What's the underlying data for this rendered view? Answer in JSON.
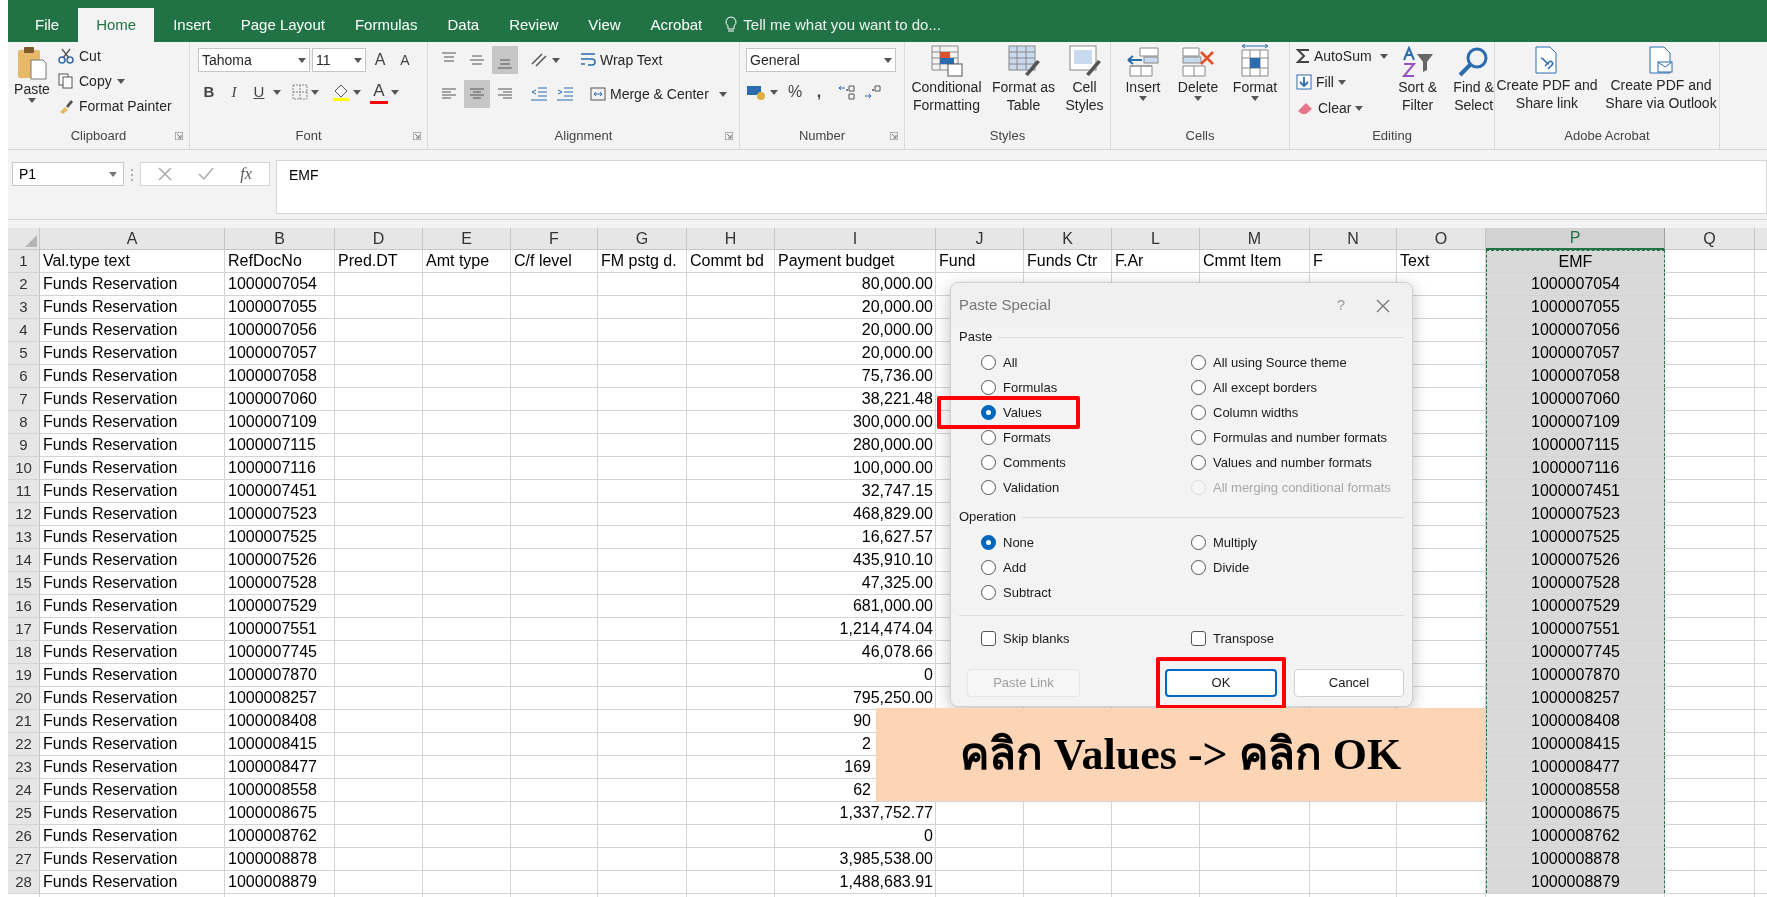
{
  "menu_tabs": [
    {
      "label": "File",
      "selected": false
    },
    {
      "label": "Home",
      "selected": true
    },
    {
      "label": "Insert",
      "selected": false
    },
    {
      "label": "Page Layout",
      "selected": false
    },
    {
      "label": "Formulas",
      "selected": false
    },
    {
      "label": "Data",
      "selected": false
    },
    {
      "label": "Review",
      "selected": false
    },
    {
      "label": "View",
      "selected": false
    },
    {
      "label": "Acrobat",
      "selected": false
    }
  ],
  "tell_me": "Tell me what you want to do...",
  "ribbon": {
    "clipboard": {
      "label": "Clipboard",
      "paste": "Paste",
      "cut": "Cut",
      "copy": "Copy",
      "format_painter": "Format Painter"
    },
    "font": {
      "label": "Font",
      "font_name": "Tahoma",
      "font_size": "11",
      "grow": "A",
      "shrink": "A",
      "bold": "B",
      "italic": "I",
      "underline": "U",
      "font_color": "A"
    },
    "alignment": {
      "label": "Alignment",
      "wrap_text": "Wrap Text",
      "merge_center": "Merge & Center",
      "vertical_buttons": [
        {
          "selected": false
        },
        {
          "selected": false
        },
        {
          "selected": true
        }
      ],
      "horizontal_buttons": [
        {
          "selected": false
        },
        {
          "selected": true
        },
        {
          "selected": false
        }
      ]
    },
    "number": {
      "label": "Number",
      "format": "General",
      "percent": "%",
      "comma": ","
    },
    "styles": {
      "label": "Styles",
      "conditional": "Conditional Formatting",
      "format_table": "Format as Table",
      "cell_styles": "Cell Styles"
    },
    "cells": {
      "label": "Cells",
      "insert": "Insert",
      "delete": "Delete",
      "format": "Format"
    },
    "editing": {
      "label": "Editing",
      "autosum": "AutoSum",
      "fill": "Fill",
      "clear": "Clear",
      "sort_filter": "Sort & Filter",
      "find_select": "Find & Select"
    },
    "acrobat": {
      "label": "Adobe Acrobat",
      "create_share": "Create PDF and Share link",
      "create_outlook": "Create PDF and Share via Outlook"
    }
  },
  "formula_bar": {
    "name_box": "P1",
    "fx": "fx",
    "formula": "EMF"
  },
  "sheet": {
    "columns": [
      {
        "letter": "A",
        "selected": false
      },
      {
        "letter": "B",
        "selected": false
      },
      {
        "letter": "D",
        "selected": false
      },
      {
        "letter": "E",
        "selected": false
      },
      {
        "letter": "F",
        "selected": false
      },
      {
        "letter": "G",
        "selected": false
      },
      {
        "letter": "H",
        "selected": false
      },
      {
        "letter": "I",
        "selected": false
      },
      {
        "letter": "J",
        "selected": false
      },
      {
        "letter": "K",
        "selected": false
      },
      {
        "letter": "L",
        "selected": false
      },
      {
        "letter": "M",
        "selected": false
      },
      {
        "letter": "N",
        "selected": false
      },
      {
        "letter": "O",
        "selected": false
      },
      {
        "letter": "P",
        "selected": true
      },
      {
        "letter": "Q",
        "selected": false
      }
    ],
    "rows": [
      {
        "row": "1",
        "kind": "labels",
        "cells": {
          "A": "Val.type text",
          "B": "RefDocNo",
          "D": "Pred.DT",
          "E": "Amt type",
          "F": "C/f level",
          "G": "FM pstg d.",
          "H": "Commt bd",
          "I": "Payment budget",
          "J": "Fund",
          "K": "Funds Ctr",
          "L": "F.Ar",
          "M": "Cmmt Item",
          "N": "F",
          "O": "Text",
          "P": "EMF"
        }
      },
      {
        "row": "2",
        "kind": "data",
        "cells": {
          "A": "Funds Reservation",
          "B": "1000007054",
          "I": "80,000.00",
          "P": "1000007054"
        }
      },
      {
        "row": "3",
        "kind": "data",
        "cells": {
          "A": "Funds Reservation",
          "B": "1000007055",
          "I": "20,000.00",
          "P": "1000007055"
        }
      },
      {
        "row": "4",
        "kind": "data",
        "cells": {
          "A": "Funds Reservation",
          "B": "1000007056",
          "I": "20,000.00",
          "P": "1000007056"
        }
      },
      {
        "row": "5",
        "kind": "data",
        "cells": {
          "A": "Funds Reservation",
          "B": "1000007057",
          "I": "20,000.00",
          "P": "1000007057"
        }
      },
      {
        "row": "6",
        "kind": "data",
        "cells": {
          "A": "Funds Reservation",
          "B": "1000007058",
          "I": "75,736.00",
          "P": "1000007058"
        }
      },
      {
        "row": "7",
        "kind": "data",
        "cells": {
          "A": "Funds Reservation",
          "B": "1000007060",
          "I": "38,221.48",
          "P": "1000007060"
        }
      },
      {
        "row": "8",
        "kind": "data",
        "cells": {
          "A": "Funds Reservation",
          "B": "1000007109",
          "I": "300,000.00",
          "P": "1000007109"
        }
      },
      {
        "row": "9",
        "kind": "data",
        "cells": {
          "A": "Funds Reservation",
          "B": "1000007115",
          "I": "280,000.00",
          "P": "1000007115"
        }
      },
      {
        "row": "10",
        "kind": "data",
        "cells": {
          "A": "Funds Reservation",
          "B": "1000007116",
          "I": "100,000.00",
          "P": "1000007116"
        }
      },
      {
        "row": "11",
        "kind": "data",
        "cells": {
          "A": "Funds Reservation",
          "B": "1000007451",
          "I": "32,747.15",
          "P": "1000007451"
        }
      },
      {
        "row": "12",
        "kind": "data",
        "cells": {
          "A": "Funds Reservation",
          "B": "1000007523",
          "I": "468,829.00",
          "P": "1000007523"
        }
      },
      {
        "row": "13",
        "kind": "data",
        "cells": {
          "A": "Funds Reservation",
          "B": "1000007525",
          "I": "16,627.57",
          "P": "1000007525"
        }
      },
      {
        "row": "14",
        "kind": "data",
        "cells": {
          "A": "Funds Reservation",
          "B": "1000007526",
          "I": "435,910.10",
          "P": "1000007526"
        }
      },
      {
        "row": "15",
        "kind": "data",
        "cells": {
          "A": "Funds Reservation",
          "B": "1000007528",
          "I": "47,325.00",
          "P": "1000007528"
        }
      },
      {
        "row": "16",
        "kind": "data",
        "cells": {
          "A": "Funds Reservation",
          "B": "1000007529",
          "I": "681,000.00",
          "P": "1000007529"
        }
      },
      {
        "row": "17",
        "kind": "data",
        "cells": {
          "A": "Funds Reservation",
          "B": "1000007551",
          "I": "1,214,474.04",
          "P": "1000007551"
        }
      },
      {
        "row": "18",
        "kind": "data",
        "cells": {
          "A": "Funds Reservation",
          "B": "1000007745",
          "I": "46,078.66",
          "P": "1000007745"
        }
      },
      {
        "row": "19",
        "kind": "data",
        "cells": {
          "A": "Funds Reservation",
          "B": "1000007870",
          "I": "0",
          "P": "1000007870"
        }
      },
      {
        "row": "20",
        "kind": "data",
        "cells": {
          "A": "Funds Reservation",
          "B": "1000008257",
          "I": "795,250.00",
          "P": "1000008257"
        }
      },
      {
        "row": "21",
        "kind": "partly_hidden",
        "cells": {
          "A": "Funds Reservation",
          "B": "1000008408",
          "I": "90",
          "P": "1000008408"
        }
      },
      {
        "row": "22",
        "kind": "partly_hidden",
        "cells": {
          "A": "Funds Reservation",
          "B": "1000008415",
          "I": "2",
          "P": "1000008415"
        }
      },
      {
        "row": "23",
        "kind": "partly_hidden",
        "cells": {
          "A": "Funds Reservation",
          "B": "1000008477",
          "I": "169",
          "P": "1000008477"
        }
      },
      {
        "row": "24",
        "kind": "partly_hidden",
        "cells": {
          "A": "Funds Reservation",
          "B": "1000008558",
          "I": "62",
          "P": "1000008558"
        }
      },
      {
        "row": "25",
        "kind": "data",
        "cells": {
          "A": "Funds Reservation",
          "B": "1000008675",
          "I": "1,337,752.77",
          "P": "1000008675"
        }
      },
      {
        "row": "26",
        "kind": "data",
        "cells": {
          "A": "Funds Reservation",
          "B": "1000008762",
          "I": "0",
          "P": "1000008762"
        }
      },
      {
        "row": "27",
        "kind": "data",
        "cells": {
          "A": "Funds Reservation",
          "B": "1000008878",
          "I": "3,985,538.00",
          "P": "1000008878"
        }
      },
      {
        "row": "28",
        "kind": "data",
        "cells": {
          "A": "Funds Reservation",
          "B": "1000008879",
          "I": "1,488,683.91",
          "P": "1000008879"
        }
      }
    ]
  },
  "dialog": {
    "title": "Paste Special",
    "help": "?",
    "paste_label": "Paste",
    "paste_options": [
      {
        "label": "All",
        "selected": false,
        "disabled": false,
        "highlighted": false
      },
      {
        "label": "All using Source theme",
        "selected": false,
        "disabled": false,
        "highlighted": false
      },
      {
        "label": "Formulas",
        "selected": false,
        "disabled": false,
        "highlighted": false
      },
      {
        "label": "All except borders",
        "selected": false,
        "disabled": false,
        "highlighted": false
      },
      {
        "label": "Values",
        "selected": true,
        "disabled": false,
        "highlighted": true
      },
      {
        "label": "Column widths",
        "selected": false,
        "disabled": false,
        "highlighted": false
      },
      {
        "label": "Formats",
        "selected": false,
        "disabled": false,
        "highlighted": false
      },
      {
        "label": "Formulas and number formats",
        "selected": false,
        "disabled": false,
        "highlighted": false
      },
      {
        "label": "Comments",
        "selected": false,
        "disabled": false,
        "highlighted": false
      },
      {
        "label": "Values and number formats",
        "selected": false,
        "disabled": false,
        "highlighted": false
      },
      {
        "label": "Validation",
        "selected": false,
        "disabled": false,
        "highlighted": false
      },
      {
        "label": "All merging conditional formats",
        "selected": false,
        "disabled": true,
        "highlighted": false
      }
    ],
    "operation_label": "Operation",
    "operation_options": [
      {
        "label": "None",
        "selected": true
      },
      {
        "label": "Multiply",
        "selected": false
      },
      {
        "label": "Add",
        "selected": false
      },
      {
        "label": "Divide",
        "selected": false
      },
      {
        "label": "Subtract",
        "selected": false
      }
    ],
    "checkboxes": [
      {
        "label": "Skip blanks",
        "checked": false
      },
      {
        "label": "Transpose",
        "checked": false
      }
    ],
    "buttons": [
      {
        "label": "Paste Link",
        "kind": "disabled",
        "highlighted": false
      },
      {
        "label": "OK",
        "kind": "default",
        "highlighted": true
      },
      {
        "label": "Cancel",
        "kind": "normal",
        "highlighted": false
      }
    ]
  },
  "banner": {
    "text": "คลิก Values -> คลิก OK"
  }
}
